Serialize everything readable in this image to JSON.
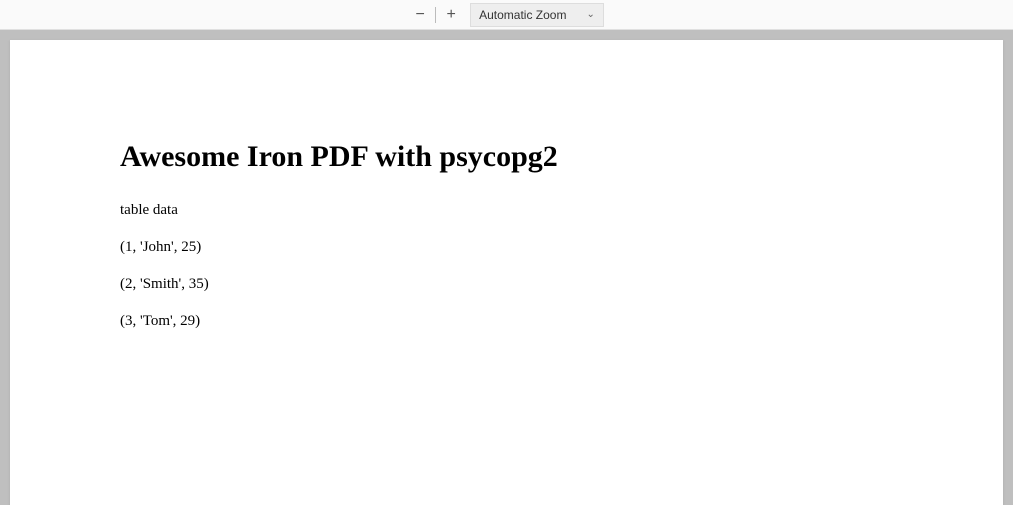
{
  "toolbar": {
    "zoom_out_label": "−",
    "zoom_in_label": "+",
    "zoom_mode": "Automatic Zoom"
  },
  "document": {
    "title": "Awesome Iron PDF with psycopg2",
    "subtitle": "table data",
    "rows": [
      "(1, 'John', 25)",
      "(2, 'Smith', 35)",
      "(3, 'Tom', 29)"
    ]
  }
}
